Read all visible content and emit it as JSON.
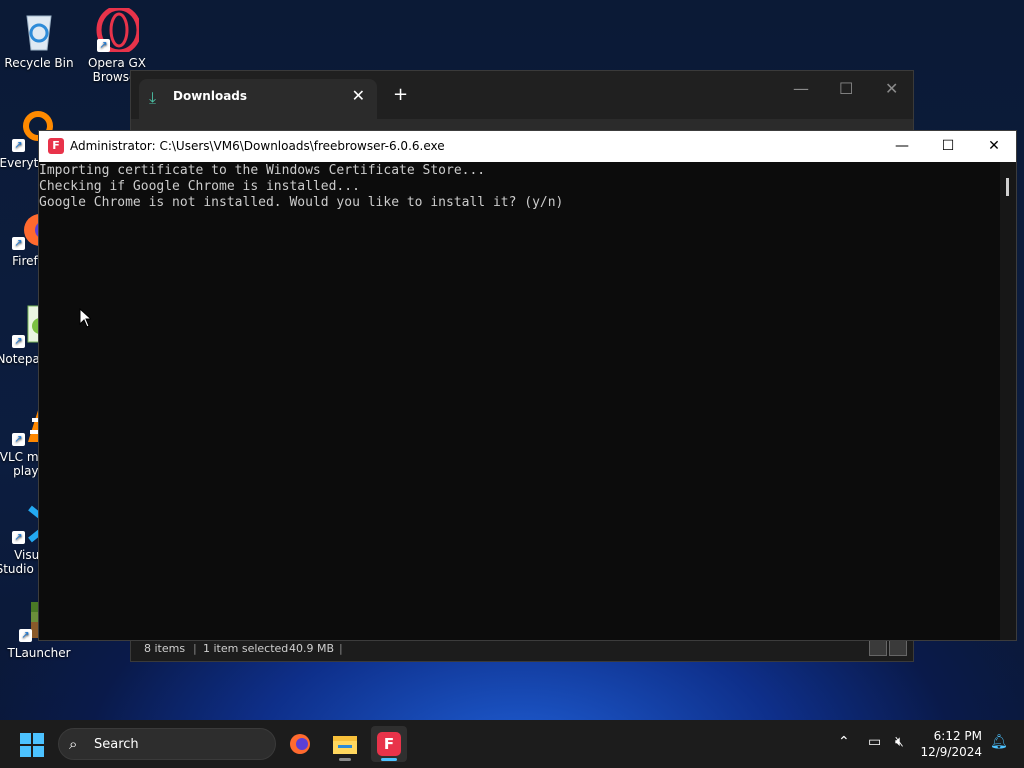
{
  "desktop": {
    "icons": [
      {
        "label": "Recycle Bin",
        "icon": "recycle-bin-icon"
      },
      {
        "label": "Opera GX Browser",
        "icon": "opera-gx-icon"
      },
      {
        "label": "Everything",
        "icon": "everything-icon"
      },
      {
        "label": "Firefox",
        "icon": "firefox-icon"
      },
      {
        "label": "Notepad++",
        "icon": "notepad-plus-plus-icon"
      },
      {
        "label": "VLC media player",
        "icon": "vlc-icon"
      },
      {
        "label": "Visual Studio Code",
        "icon": "vscode-icon"
      },
      {
        "label": "TLauncher",
        "icon": "tlauncher-icon"
      }
    ]
  },
  "explorer": {
    "tab_title": "Downloads",
    "status": {
      "items": "8 items",
      "selected": "1 item selected",
      "size": "40.9 MB"
    }
  },
  "console": {
    "title": "Administrator: C:\\Users\\VM6\\Downloads\\freebrowser-6.0.6.exe",
    "lines": [
      "Importing certificate to the Windows Certificate Store...",
      "Checking if Google Chrome is installed...",
      "Google Chrome is not installed. Would you like to install it? (y/n)"
    ]
  },
  "taskbar": {
    "search_label": "Search",
    "apps": [
      "firefox-icon",
      "file-explorer-icon",
      "freebrowser-icon"
    ],
    "clock": {
      "time": "6:12 PM",
      "date": "12/9/2024"
    }
  },
  "colors": {
    "accent": "#4cc2ff",
    "freebrowser": "#e8334a",
    "console_bg": "#0c0c0c"
  }
}
